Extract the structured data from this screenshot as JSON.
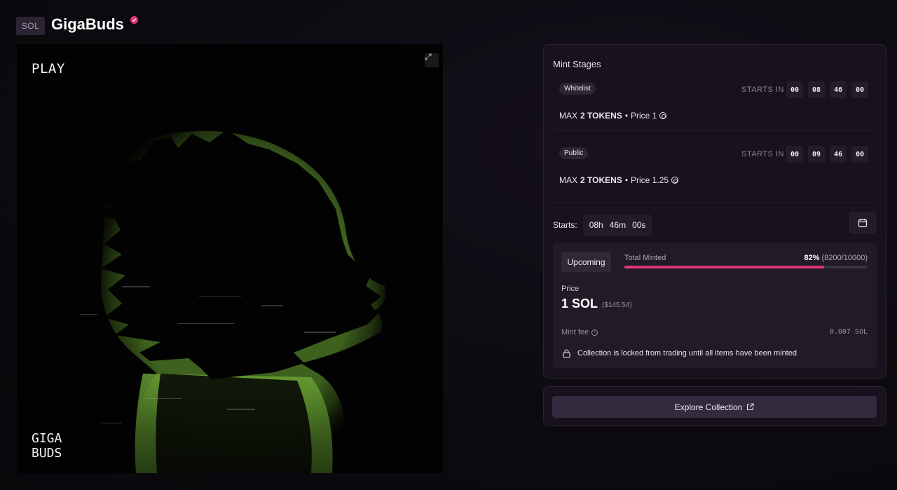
{
  "header": {
    "chain_badge": "SOL",
    "title": "GigaBuds"
  },
  "artwork": {
    "play_label": "PLAY",
    "logo_line1": "GIGA",
    "logo_line2": "BUDS",
    "glow_color": "#8fd04a"
  },
  "mint_panel": {
    "title": "Mint Stages",
    "stages": [
      {
        "tag": "Whitelist",
        "starts_in_label": "STARTS IN",
        "countdown": [
          "00",
          "08",
          "46",
          "00"
        ],
        "max_label": "MAX",
        "max_value": "2 TOKENS",
        "bullet": "•",
        "price_text": "Price 1"
      },
      {
        "tag": "Public",
        "starts_in_label": "STARTS IN",
        "countdown": [
          "00",
          "09",
          "46",
          "00"
        ],
        "max_label": "MAX",
        "max_value": "2 TOKENS",
        "bullet": "•",
        "price_text": "Price 1.25"
      }
    ],
    "starts_label": "Starts:",
    "starts_h": "08h",
    "starts_m": "46m",
    "starts_s": "00s",
    "status": "Upcoming",
    "total_minted_label": "Total Minted",
    "minted_pct": "82%",
    "minted_count": "(8200/10000)",
    "minted_fraction": 0.82,
    "price_label": "Price",
    "price_value": "1 SOL",
    "price_usd": "($145.54)",
    "fee_label": "Mint fee",
    "fee_value": "0.007 SOL",
    "lock_notice": "Collection is locked from trading until all items have been minted",
    "accent_color": "#e0347a"
  },
  "explore": {
    "button_label": "Explore Collection"
  }
}
